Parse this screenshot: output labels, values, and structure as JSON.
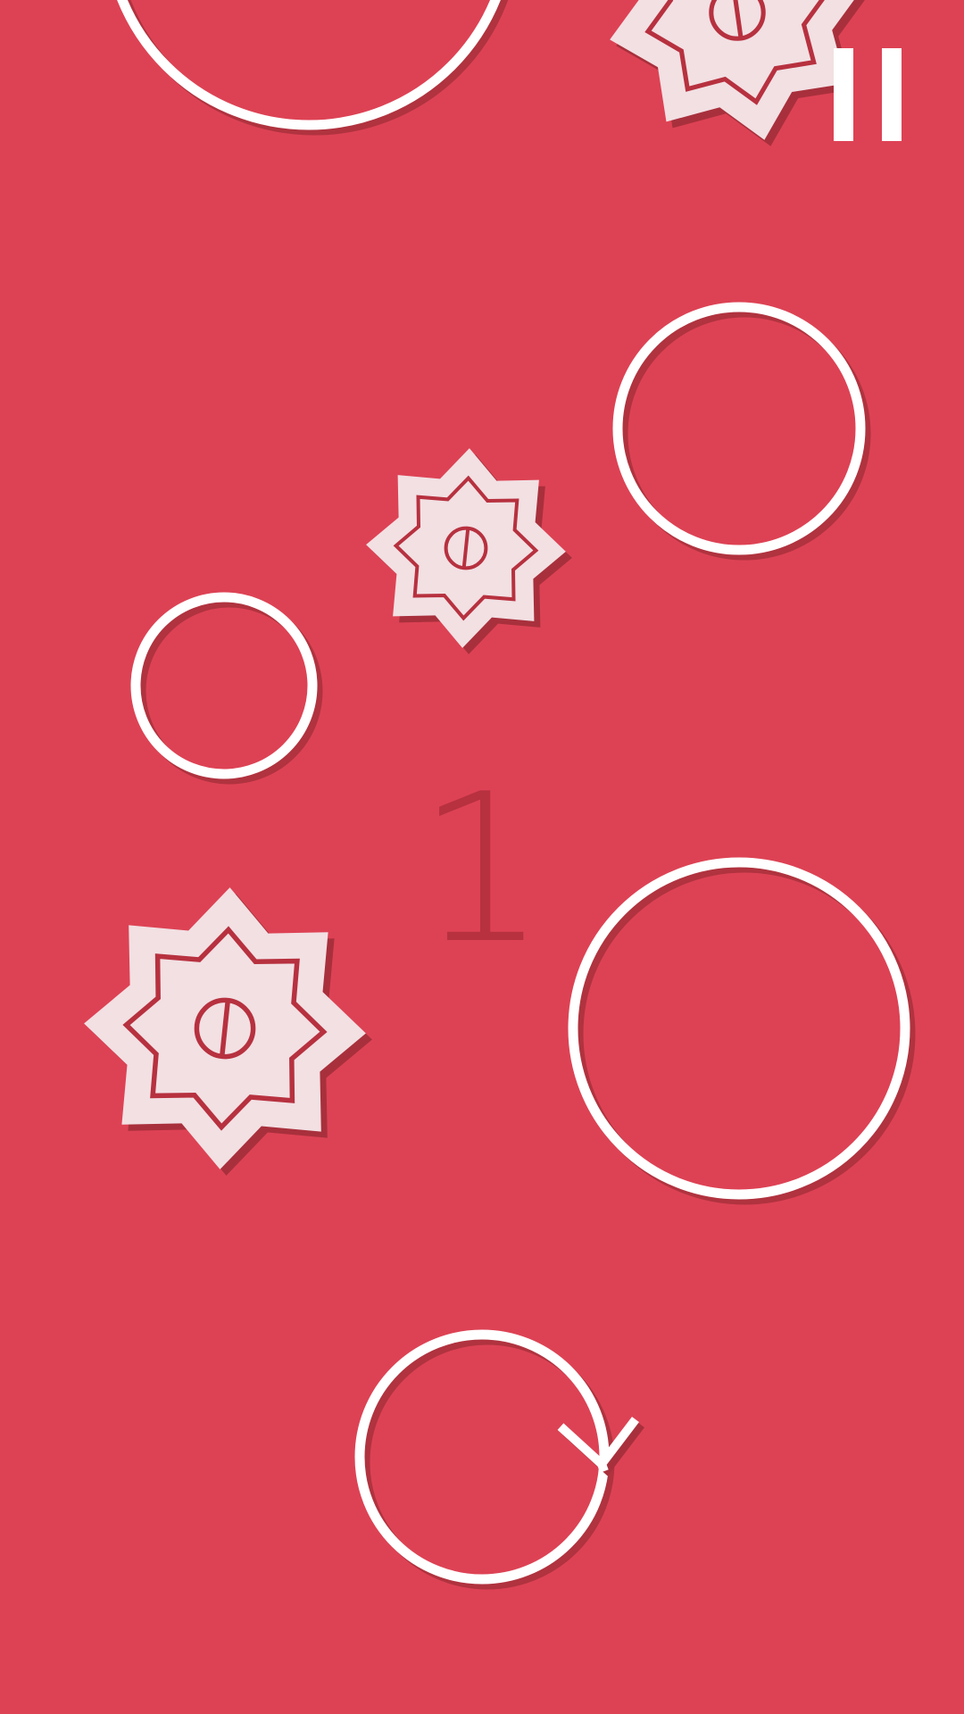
{
  "screen": {
    "name": "gameplay",
    "background_color": "#DD4254"
  },
  "hud": {
    "score": "1",
    "score_color": "#B7313F",
    "pause": {
      "icon": "pause-icon",
      "color": "#FFFFFF"
    }
  },
  "palette": {
    "ring_stroke": "#FFFFFF",
    "shadow": "#A8303C",
    "star_fill": "#F2E0E3",
    "star_detail": "#B7313F"
  },
  "icons": {
    "ring": "ring-obstacle-icon",
    "saw": "saw-blade-icon",
    "player": "player-arrow-ring-icon"
  }
}
